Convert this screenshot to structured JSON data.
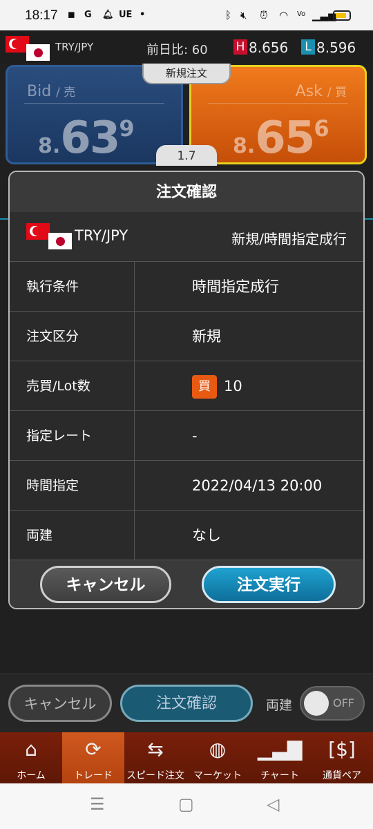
{
  "status_bar": {
    "time": "18:17",
    "notification_icons": [
      "line-icon",
      "google-icon",
      "bell-icon",
      "ue-icon",
      "dot-icon"
    ],
    "ue_label": "UE",
    "system_icons": [
      "bluetooth-icon",
      "mute-icon",
      "alarm-icon",
      "wifi-icon",
      "volte-icon",
      "signal-icon",
      "battery-icon"
    ],
    "battery_color": "#f4c000"
  },
  "header": {
    "pair": "TRY/JPY",
    "change_label": "前日比: 60",
    "high_badge": "H",
    "high_value": "8.656",
    "low_badge": "L",
    "low_value": "8.596",
    "high_color": "#c8102e",
    "low_color": "#1a8fb0"
  },
  "quote": {
    "bid_label": "Bid",
    "bid_sub": "/ 売",
    "bid_small": "8.",
    "bid_big": "63",
    "bid_sup": "9",
    "ask_label": "Ask",
    "ask_sub": "/ 買",
    "ask_small": "8.",
    "ask_big": "65",
    "ask_sup": "6",
    "new_order_tab": "新規注文",
    "spread": "1.7"
  },
  "dialog": {
    "title": "注文確認",
    "pair": "TRY/JPY",
    "order_type_summary": "新規/時間指定成行",
    "rows": [
      {
        "key": "執行条件",
        "value": "時間指定成行"
      },
      {
        "key": "注文区分",
        "value": "新規"
      },
      {
        "key": "売買/Lot数",
        "badge": "買",
        "value": "10"
      },
      {
        "key": "指定レート",
        "value": "-"
      },
      {
        "key": "時間指定",
        "value": "2022/04/13 20:00"
      },
      {
        "key": "両建",
        "value": "なし"
      }
    ],
    "cancel_label": "キャンセル",
    "execute_label": "注文実行"
  },
  "bottom_controls": {
    "cancel_label": "キャンセル",
    "confirm_label": "注文確認",
    "hedge_label": "両建",
    "toggle_state": "OFF"
  },
  "tabs": [
    {
      "label": "ホーム",
      "icon": "home-icon"
    },
    {
      "label": "トレード",
      "icon": "trade-icon",
      "active": true
    },
    {
      "label": "スピード注文",
      "icon": "speed-order-icon"
    },
    {
      "label": "マーケット",
      "icon": "globe-icon"
    },
    {
      "label": "チャート",
      "icon": "chart-icon"
    },
    {
      "label": "通貨ペア",
      "icon": "currency-pair-icon"
    }
  ],
  "nav_bar": [
    "recents-icon",
    "home-nav-icon",
    "back-icon"
  ]
}
